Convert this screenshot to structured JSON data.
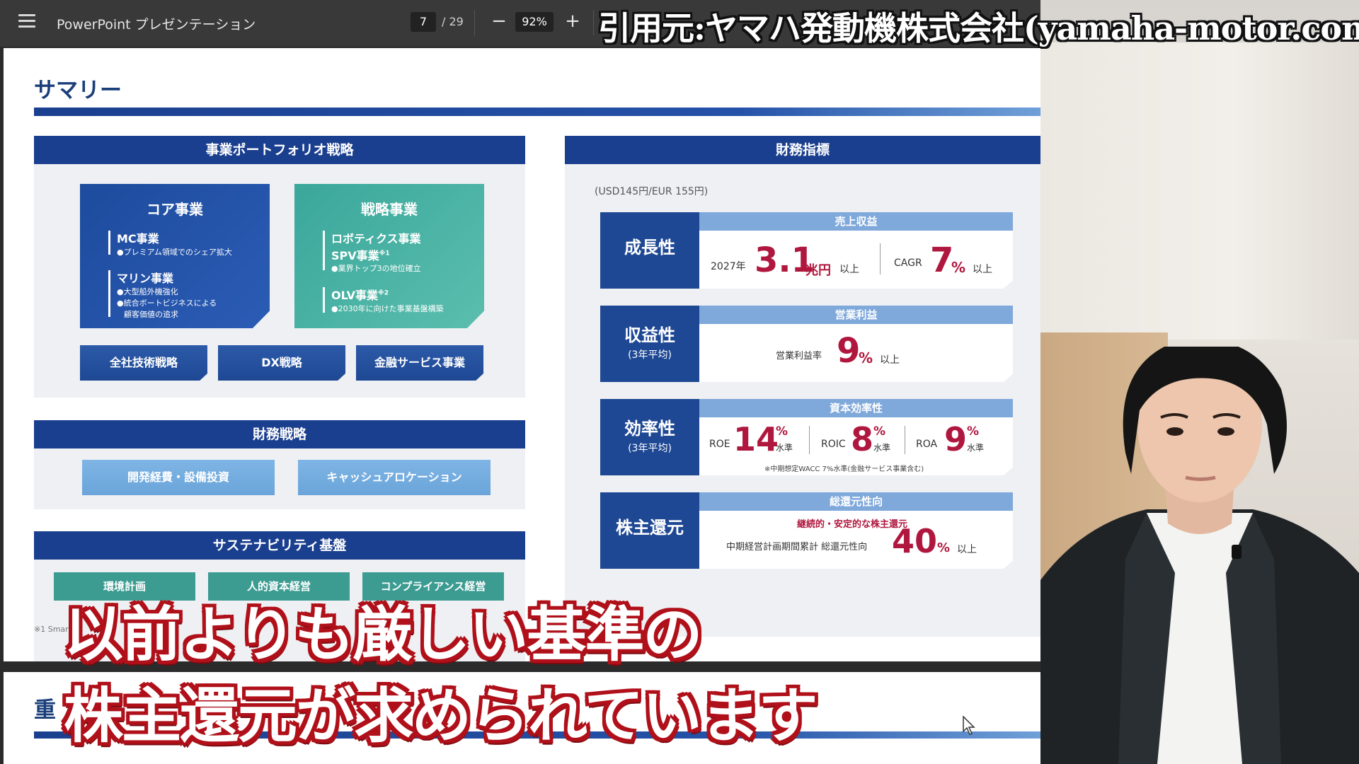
{
  "toolbar": {
    "title": "PowerPoint プレゼンテーション",
    "page_current": "7",
    "page_total": "/ 29",
    "zoom": "92%",
    "zoom_minus": "−",
    "zoom_plus": "+"
  },
  "credit": "引用元:ヤマハ発動機株式会社(yamaha-motor.com)",
  "slide": {
    "title": "サマリー",
    "portfolio": {
      "header": "事業ポートフォリオ戦略",
      "core": {
        "title": "コア事業",
        "item1": "MC事業",
        "item1_sub": "●プレミアム領域でのシェア拡大",
        "item2": "マリン事業",
        "item2_sub1": "●大型船外機強化",
        "item2_sub2": "●統合ボートビジネスによる",
        "item2_sub3": "顧客価値の追求"
      },
      "strategic": {
        "title": "戦略事業",
        "item1": "ロボティクス事業",
        "item2": "SPV事業",
        "item2_note": "※1",
        "item2_sub": "●業界トップ3の地位確立",
        "item3": "OLV事業",
        "item3_note": "※2",
        "item3_sub": "●2030年に向けた事業基盤構築"
      },
      "buttons": [
        "全社技術戦略",
        "DX戦略",
        "金融サービス事業"
      ]
    },
    "financial_strategy": {
      "header": "財務戦略",
      "buttons": [
        "開発経費・設備投資",
        "キャッシュアロケーション"
      ]
    },
    "sustainability": {
      "header": "サステナビリティ基盤",
      "buttons": [
        "環境計画",
        "人的資本経営",
        "コンプライアンス経営"
      ]
    },
    "footnote": "※1 Smar",
    "indicators": {
      "header": "財務指標",
      "fx": "(USD145円/EUR 155円)",
      "growth": {
        "label": "成長性",
        "caption": "売上収益",
        "year": "2027年",
        "value": "3.1",
        "unit": "兆円",
        "suffix": "以上",
        "cagr_label": "CAGR",
        "cagr_value": "7",
        "cagr_unit": "%",
        "cagr_suffix": "以上"
      },
      "profitability": {
        "label": "収益性",
        "sublabel": "(3年平均)",
        "caption": "営業利益",
        "metric": "営業利益率",
        "value": "9",
        "unit": "%",
        "suffix": "以上"
      },
      "efficiency": {
        "label": "効率性",
        "sublabel": "(3年平均)",
        "caption": "資本効率性",
        "roe_label": "ROE",
        "roe_value": "14",
        "roic_label": "ROIC",
        "roic_value": "8",
        "roa_label": "ROA",
        "roa_value": "9",
        "unit": "%",
        "level": "水準",
        "note": "※中期想定WACC 7%水準(金融サービス事業含む)"
      },
      "shareholder": {
        "label": "株主還元",
        "caption": "総還元性向",
        "policy": "継続的・安定的な株主還元",
        "metric": "中期経営計画期間累計 総還元性向",
        "value": "40",
        "unit": "%",
        "suffix": "以上"
      }
    }
  },
  "next_slide": {
    "title": "重"
  },
  "subtitles": {
    "line1": "以前よりも厳しい基準の",
    "line2": "株主還元が求められています"
  },
  "colors": {
    "navy": "#1b3f8f",
    "teal": "#3aa79b",
    "accent_red": "#b0173e",
    "subtitle_outline": "#b01019"
  }
}
